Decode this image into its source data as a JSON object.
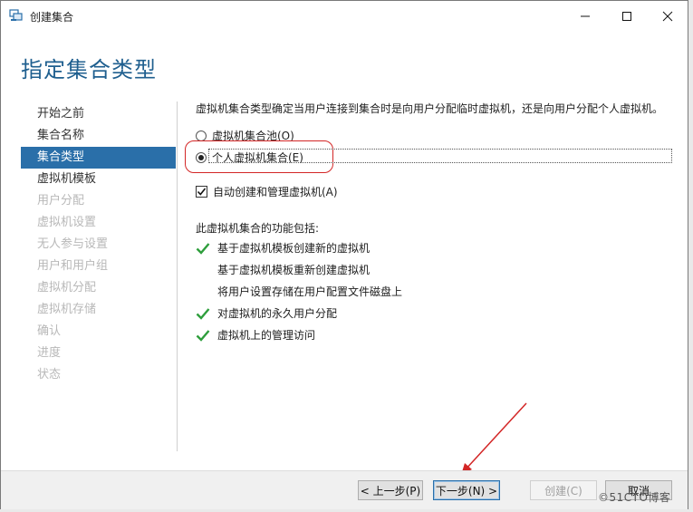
{
  "window": {
    "title": "创建集合"
  },
  "heading": "指定集合类型",
  "nav": {
    "items": [
      {
        "label": "开始之前",
        "state": "normal"
      },
      {
        "label": "集合名称",
        "state": "normal"
      },
      {
        "label": "集合类型",
        "state": "active"
      },
      {
        "label": "虚拟机模板",
        "state": "normal"
      },
      {
        "label": "用户分配",
        "state": "disabled"
      },
      {
        "label": "虚拟机设置",
        "state": "disabled"
      },
      {
        "label": "无人参与设置",
        "state": "disabled"
      },
      {
        "label": "用户和用户组",
        "state": "disabled"
      },
      {
        "label": "虚拟机分配",
        "state": "disabled"
      },
      {
        "label": "虚拟机存储",
        "state": "disabled"
      },
      {
        "label": "确认",
        "state": "disabled"
      },
      {
        "label": "进度",
        "state": "disabled"
      },
      {
        "label": "状态",
        "state": "disabled"
      }
    ]
  },
  "content": {
    "description": "虚拟机集合类型确定当用户连接到集合时是向用户分配临时虚拟机，还是向用户分配个人虚拟机。",
    "radio_pooled": "虚拟机集合池(O)",
    "radio_personal": "个人虚拟机集合(E)",
    "checkbox_auto": "自动创建和管理虚拟机(A)",
    "features_title": "此虚拟机集合的功能包括:",
    "features": [
      {
        "label": "基于虚拟机模板创建新的虚拟机",
        "checked": true
      },
      {
        "label": "基于虚拟机模板重新创建虚拟机",
        "checked": false
      },
      {
        "label": "将用户设置存储在用户配置文件磁盘上",
        "checked": false
      },
      {
        "label": "对虚拟机的永久用户分配",
        "checked": true
      },
      {
        "label": "虚拟机上的管理访问",
        "checked": true
      }
    ]
  },
  "footer": {
    "prev": "< 上一步(P)",
    "next": "下一步(N) >",
    "create": "创建(C)",
    "cancel": "取消"
  },
  "watermark": "©51CTO博客",
  "colors": {
    "accent": "#2a6fa9",
    "heading": "#1f5f8f",
    "check": "#2e9e3c",
    "annotation": "#d32626"
  }
}
